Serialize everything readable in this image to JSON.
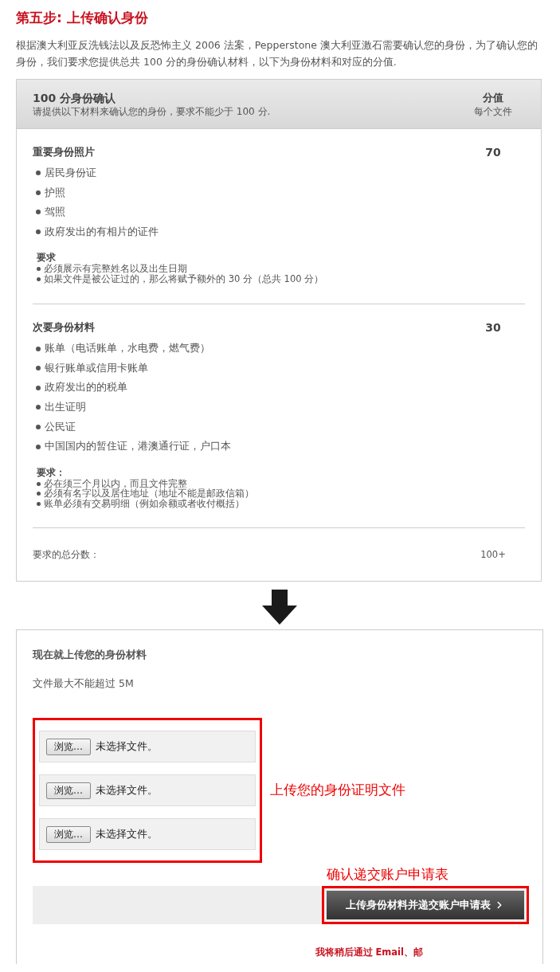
{
  "title": "第五步: 上传确认身份",
  "intro": "根据澳大利亚反洗钱法以及反恐怖主义 2006 法案，Pepperstone 澳大利亚激石需要确认您的身份，为了确认您的身份，我们要求您提供总共 100 分的身份确认材料，以下为身份材料和对应的分值.",
  "id_table": {
    "header": {
      "title": "100 分身份确认",
      "subtitle": "请提供以下材料来确认您的身份，要求不能少于 100 分.",
      "score_label": "分值",
      "score_sub": "每个文件"
    },
    "sections": [
      {
        "title": "重要身份照片",
        "points": "70",
        "items": [
          "居民身份证",
          "护照",
          "驾照",
          "政府发出的有相片的证件"
        ],
        "requirements_title": "要求",
        "requirements": [
          "必须展示有完整姓名以及出生日期",
          "如果文件是被公证过的，那么将赋予额外的 30 分（总共 100 分）"
        ]
      },
      {
        "title": "次要身份材料",
        "points": "30",
        "items": [
          "账单（电话账单，水电费，燃气费）",
          "银行账单或信用卡账单",
          "政府发出的的税单",
          "出生证明",
          "公民证",
          "中国国内的暂住证，港澳通行证，户口本"
        ],
        "requirements_title": "要求：",
        "requirements": [
          "必在须三个月以内，而且文件完整",
          "必须有名字以及居住地址（地址不能是邮政信箱）",
          "账单必须有交易明细（例如余额或者收付概括）"
        ]
      }
    ],
    "total": {
      "label": "要求的总分数：",
      "value": "100+"
    }
  },
  "upload": {
    "title": "现在就上传您的身份材料",
    "note": "文件最大不能超过 5M",
    "files": [
      {
        "button": "浏览…",
        "status": "未选择文件。"
      },
      {
        "button": "浏览…",
        "status": "未选择文件。"
      },
      {
        "button": "浏览…",
        "status": "未选择文件。"
      }
    ],
    "annotation_files": "上传您的身份证明文件",
    "annotation_submit": "确认递交账户申请表",
    "submit": "上传身份材料并递交账户申请表",
    "footer_note": "我将稍后通过 Email、邮"
  }
}
